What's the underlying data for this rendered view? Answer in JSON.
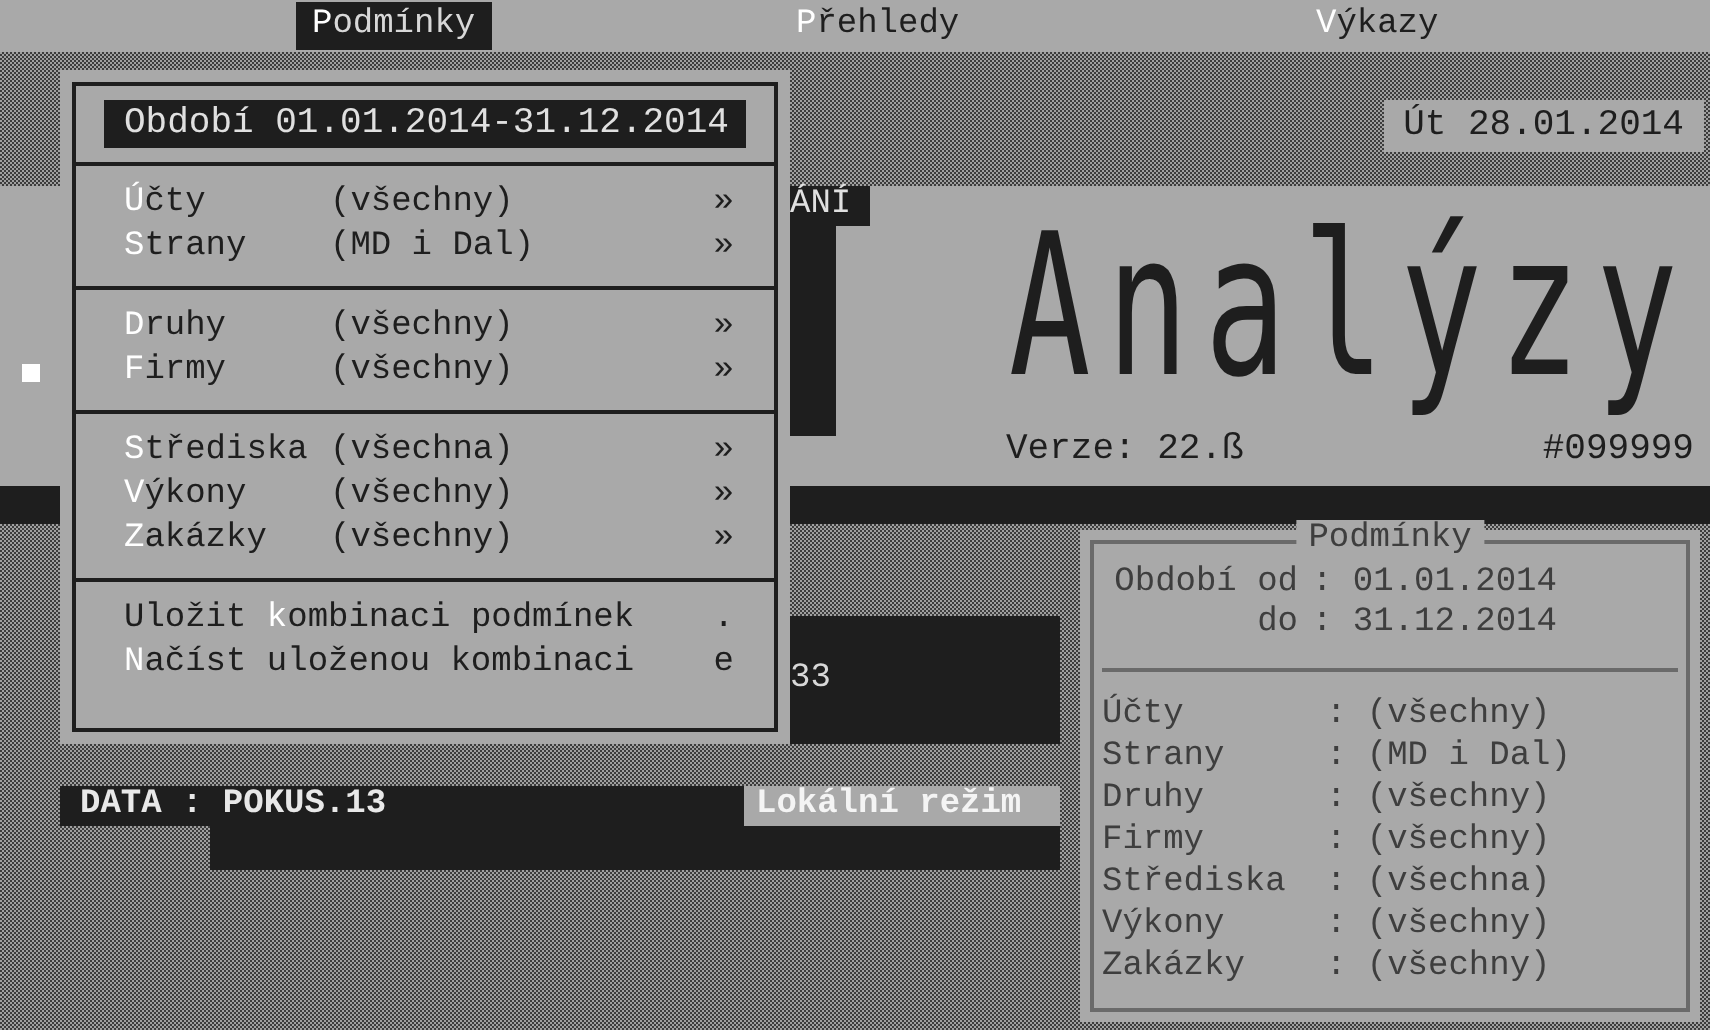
{
  "menu_bar": [
    {
      "hotkey": "P",
      "rest": "odmínky",
      "selected": true
    },
    {
      "hotkey": "P",
      "rest": "řehledy",
      "selected": false
    },
    {
      "hotkey": "V",
      "rest": "ýkazy",
      "selected": false
    }
  ],
  "date": "Út 28.01.2014",
  "title_panel": {
    "label": "ÁNÍ",
    "title": "Analýzy",
    "version": "Verze: 22.ß",
    "serial": "#099999"
  },
  "popup": {
    "period": "Období 01.01.2014-31.12.2014",
    "sections": [
      [
        {
          "hotkey": "Ú",
          "rest": "čty",
          "value": "(všechny)",
          "mark": "»"
        },
        {
          "hotkey": "S",
          "rest": "trany",
          "value": "(MD i Dal)",
          "mark": "»"
        }
      ],
      [
        {
          "hotkey": "D",
          "rest": "ruhy",
          "value": "(všechny)",
          "mark": "»"
        },
        {
          "hotkey": "F",
          "rest": "irmy",
          "value": "(všechny)",
          "mark": "»"
        }
      ],
      [
        {
          "hotkey": "S",
          "rest": "třediska",
          "value": "(všechna)",
          "mark": "»"
        },
        {
          "hotkey": "V",
          "rest": "ýkony",
          "value": "(všechny)",
          "mark": "»"
        },
        {
          "hotkey": "Z",
          "rest": "akázky",
          "value": "(všechny)",
          "mark": "»"
        }
      ],
      [
        {
          "before": "Uložit ",
          "hotkey": "k",
          "rest": "ombinaci podmínek",
          "mark": "."
        },
        {
          "hotkey": "N",
          "rest": "ačíst uloženou kombinaci",
          "mark": "e"
        }
      ]
    ]
  },
  "hidden_box_text": "33",
  "status": {
    "data": "DATA : POKUS.13",
    "mode": "Lokální režim"
  },
  "conditions_panel": {
    "title": "Podmínky",
    "period": [
      {
        "label": "Období od",
        "value": ": 01.01.2014"
      },
      {
        "label": "do",
        "value": ": 31.12.2014"
      }
    ],
    "rows": [
      {
        "label": "Účty",
        "value": ": (všechny)"
      },
      {
        "label": "Strany",
        "value": ": (MD i Dal)"
      },
      {
        "label": "Druhy",
        "value": ": (všechny)"
      },
      {
        "label": "Firmy",
        "value": ": (všechny)"
      },
      {
        "label": "Střediska",
        "value": ": (všechna)"
      },
      {
        "label": "Výkony",
        "value": ": (všechny)"
      },
      {
        "label": "Zakázky",
        "value": ": (všechny)"
      }
    ]
  }
}
